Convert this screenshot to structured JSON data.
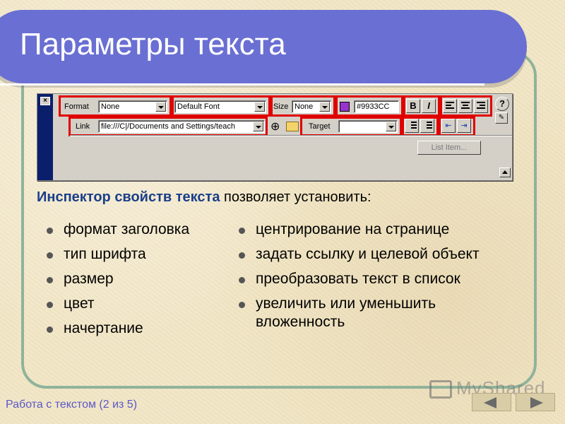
{
  "slide": {
    "title": "Параметры текста",
    "lead_bold": "Инспектор свойств текста",
    "lead_rest": " позволяет установить:",
    "left_bullets": [
      "формат заголовка",
      "тип шрифта",
      "размер",
      "цвет",
      "начертание"
    ],
    "right_bullets": [
      "центрирование на странице",
      "задать ссылку и целевой объект",
      "преобразовать текст в список",
      "увеличить или уменьшить вложенность"
    ],
    "footer": "Работа с текстом (2 из 5)",
    "watermark": "MyShared"
  },
  "inspector": {
    "close_label": "×",
    "format_label": "Format",
    "format_value": "None",
    "font_value": "Default Font",
    "size_label": "Size",
    "size_value": "None",
    "color_value": "#9933CC",
    "bold_label": "B",
    "italic_label": "I",
    "help_label": "?",
    "link_label": "Link",
    "link_value": "file:///C|/Documents and Settings/teach",
    "target_label": "Target",
    "target_value": "",
    "list_item_label": "List Item..."
  },
  "colors": {
    "title_bar": "#6a6fd3",
    "frame": "#8fb39b",
    "highlight": "#e00000",
    "text_color_swatch": "#9933cc",
    "footer_text": "#5a58c8"
  },
  "icons": [
    "close-icon",
    "point-to-file-icon",
    "folder-icon",
    "align-left-icon",
    "align-center-icon",
    "align-right-icon",
    "unordered-list-icon",
    "ordered-list-icon",
    "outdent-icon",
    "indent-icon",
    "help-icon",
    "edit-icon",
    "expand-arrow-icon",
    "prev-arrow-icon",
    "next-arrow-icon"
  ]
}
